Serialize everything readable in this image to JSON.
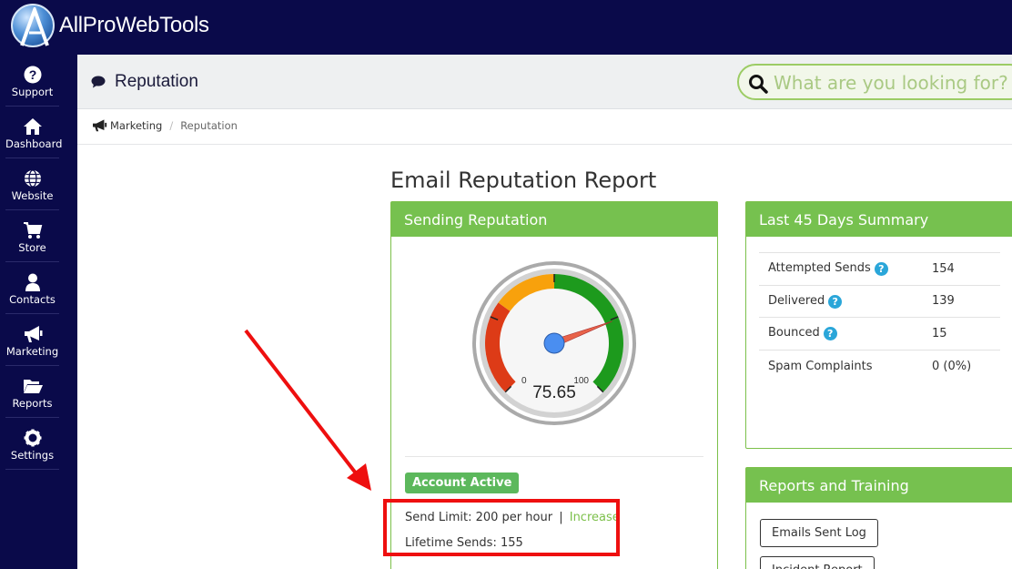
{
  "app": {
    "name": "AllProWebTools"
  },
  "sidebar": {
    "items": [
      {
        "label": "Support",
        "icon": "question-circle-icon"
      },
      {
        "label": "Dashboard",
        "icon": "home-icon"
      },
      {
        "label": "Website",
        "icon": "globe-icon"
      },
      {
        "label": "Store",
        "icon": "cart-icon"
      },
      {
        "label": "Contacts",
        "icon": "user-icon"
      },
      {
        "label": "Marketing",
        "icon": "megaphone-icon"
      },
      {
        "label": "Reports",
        "icon": "folder-open-icon"
      },
      {
        "label": "Settings",
        "icon": "gear-icon"
      }
    ]
  },
  "header": {
    "title": "Reputation",
    "search_placeholder": "What are you looking for? (S"
  },
  "breadcrumb": {
    "parent": "Marketing",
    "separator": "/",
    "current": "Reputation"
  },
  "report": {
    "title": "Email Reputation Report",
    "sending_panel": {
      "title": "Sending Reputation",
      "gauge": {
        "value": 75.65,
        "value_label": "75.65",
        "min": 0,
        "min_label": "0",
        "max": 100,
        "max_label": "100"
      },
      "status_badge": "Account Active",
      "send_limit_label": "Send Limit: 200 per hour",
      "separator": "|",
      "increase_link": "Increase",
      "lifetime_sends": "Lifetime Sends: 155"
    },
    "summary_panel": {
      "title": "Last 45 Days Summary",
      "rows": [
        {
          "label": "Attempted Sends",
          "value": "154",
          "help": "?"
        },
        {
          "label": "Delivered",
          "value": "139",
          "help": "?"
        },
        {
          "label": "Bounced",
          "value": "15",
          "help": "?"
        },
        {
          "label": "Spam Complaints",
          "value": "0 (0%)",
          "help": ""
        }
      ]
    },
    "training_panel": {
      "title": "Reports and Training",
      "buttons": [
        "Emails Sent Log",
        "Incident Report"
      ]
    }
  },
  "colors": {
    "nav_bg": "#0a0a4a",
    "panel_green": "#76c14f",
    "badge_green": "#5cb85c",
    "highlight_red": "#ee0f0f",
    "help_blue": "#2aa6d9"
  }
}
